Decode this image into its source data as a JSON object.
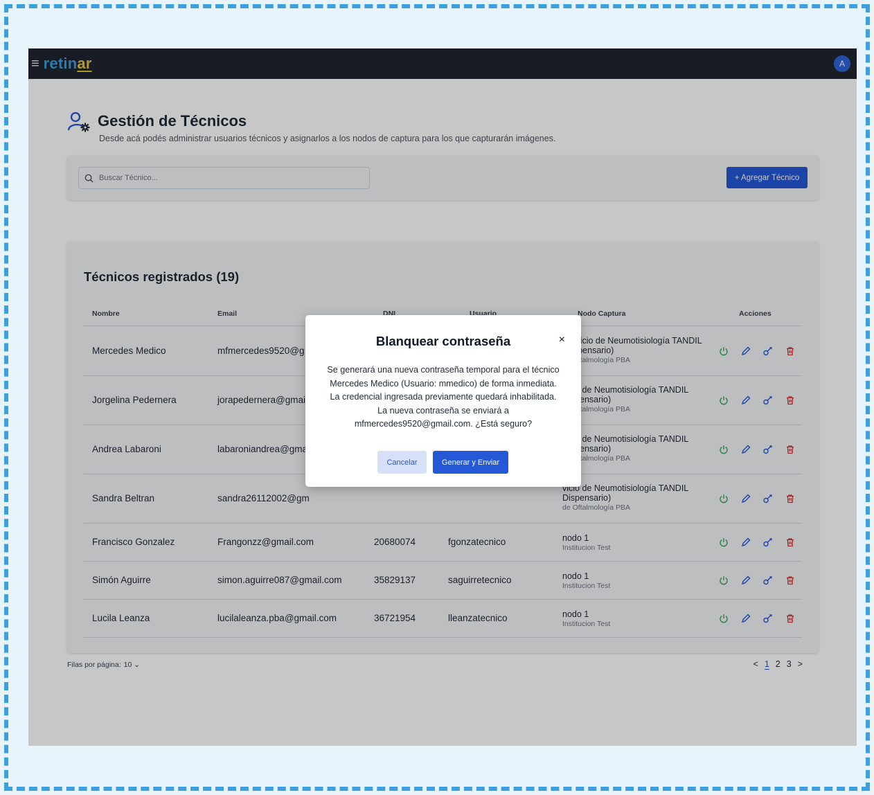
{
  "app": {
    "logo_part1": "retin",
    "logo_part2": "ar",
    "avatar_initial": "A"
  },
  "page": {
    "title": "Gestión de Técnicos",
    "subtitle": "Desde acá podés administrar usuarios técnicos y asignarlos a los nodos de captura para los que capturarán imágenes."
  },
  "search": {
    "placeholder": "Buscar Técnico..."
  },
  "toolbar": {
    "add_label": "+ Agregar Técnico"
  },
  "table": {
    "title": "Técnicos registrados (19)",
    "columns": [
      "Nombre",
      "Email",
      "DNI",
      "Usuario",
      "Nodo Captura",
      "Acciones"
    ],
    "rows": [
      {
        "nombre": "Mercedes Medico",
        "email": "mfmercedes9520@g",
        "dni": "",
        "usuario": "",
        "nodo": "Servicio de Neumotisiología TANDIL",
        "nodo2": "(Dispensario)",
        "institucion": "de Oftalmología PBA"
      },
      {
        "nombre": "Jorgelina Pedernera",
        "email": "jorapedernera@gmai",
        "dni": "",
        "usuario": "",
        "nodo": "vicio de Neumotisiología TANDIL",
        "nodo2": "Dispensario)",
        "institucion": "de Oftalmología PBA"
      },
      {
        "nombre": "Andrea Labaroni",
        "email": "labaroniandrea@gma",
        "dni": "",
        "usuario": "",
        "nodo": "vicio de Neumotisiología TANDIL",
        "nodo2": "Dispensario)",
        "institucion": "de Oftalmología PBA"
      },
      {
        "nombre": "Sandra Beltran",
        "email": "sandra26112002@gm",
        "dni": "",
        "usuario": "",
        "nodo": "vicio de Neumotisiología TANDIL",
        "nodo2": "Dispensario)",
        "institucion": "de Oftalmología PBA"
      },
      {
        "nombre": "Francisco Gonzalez",
        "email": "Frangonzz@gmail.com",
        "dni": "20680074",
        "usuario": "fgonzatecnico",
        "nodo": "nodo 1",
        "institucion": "Institucion Test"
      },
      {
        "nombre": "Simón Aguirre",
        "email": "simon.aguirre087@gmail.com",
        "dni": "35829137",
        "usuario": "saguirretecnico",
        "nodo": "nodo 1",
        "institucion": "Institucion Test"
      },
      {
        "nombre": "Lucila Leanza",
        "email": "lucilaleanza.pba@gmail.com",
        "dni": "36721954",
        "usuario": "lleanzatecnico",
        "nodo": "nodo 1",
        "institucion": "Institucion Test"
      }
    ]
  },
  "footer": {
    "rows_label": "Filas por página:",
    "rows_value": "10",
    "prev": "<",
    "pages": [
      "1",
      "2",
      "3"
    ],
    "next": ">"
  },
  "modal": {
    "title": "Blanquear contraseña",
    "close": "×",
    "body_lines": [
      "Se generará una nueva contraseña temporal para el técnico",
      "Mercedes Medico (Usuario: mmedico) de forma inmediata.",
      "La credencial ingresada previamente quedará inhabilitada.",
      "La nueva contraseña se enviará a",
      "mfmercedes9520@gmail.com. ¿Está seguro?"
    ],
    "cancel_label": "Cancelar",
    "confirm_label": "Generar y Enviar"
  },
  "colors": {
    "accent": "#2458d6",
    "power": "#3aa35a",
    "edit": "#2458d6",
    "key": "#2458d6",
    "delete": "#d32f2f"
  }
}
